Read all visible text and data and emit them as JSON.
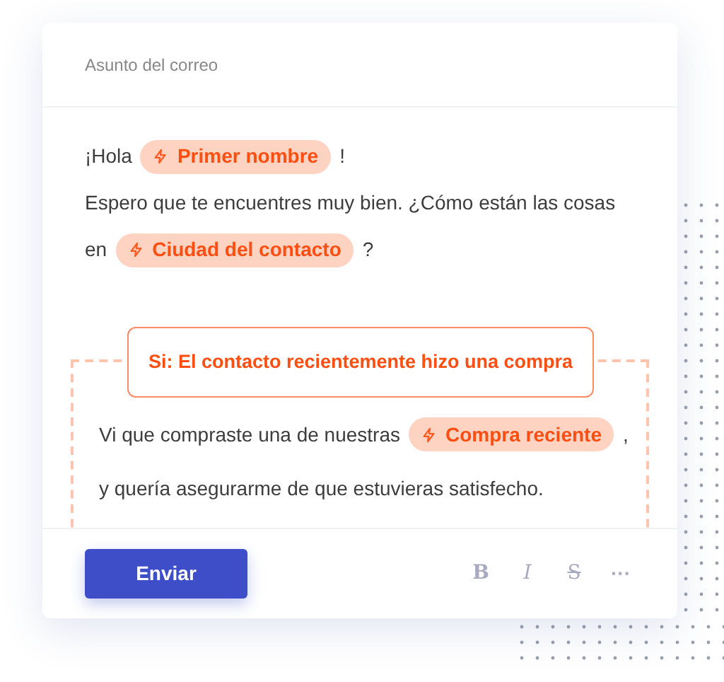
{
  "subject": {
    "placeholder": "Asunto del correo"
  },
  "lines": [
    {
      "parts": [
        {
          "kind": "text",
          "text": "¡Hola"
        },
        {
          "kind": "chip",
          "text": "Primer nombre"
        },
        {
          "kind": "text",
          "text": "!"
        }
      ]
    },
    {
      "parts": [
        {
          "kind": "text",
          "text": "Espero que te encuentres muy bien. ¿Cómo están las cosas"
        }
      ]
    },
    {
      "parts": [
        {
          "kind": "text",
          "text": "en"
        },
        {
          "kind": "chip",
          "text": "Ciudad del contacto"
        },
        {
          "kind": "text",
          "text": "?"
        }
      ]
    }
  ],
  "condition": {
    "label": "Si: El contacto recientemente hizo una compra",
    "lines": [
      {
        "parts": [
          {
            "kind": "text",
            "text": "Vi que compraste una de nuestras"
          },
          {
            "kind": "chip",
            "text": "Compra reciente"
          },
          {
            "kind": "text",
            "text": ","
          }
        ]
      },
      {
        "parts": [
          {
            "kind": "text",
            "text": "y quería asegurarme de que estuvieras satisfecho."
          }
        ]
      }
    ]
  },
  "send_button": "Enviar",
  "format_buttons": [
    {
      "kind": "bold",
      "text": "B"
    },
    {
      "kind": "italic",
      "text": "I"
    },
    {
      "kind": "strike",
      "text": "S"
    },
    {
      "kind": "more",
      "text": "···"
    }
  ]
}
